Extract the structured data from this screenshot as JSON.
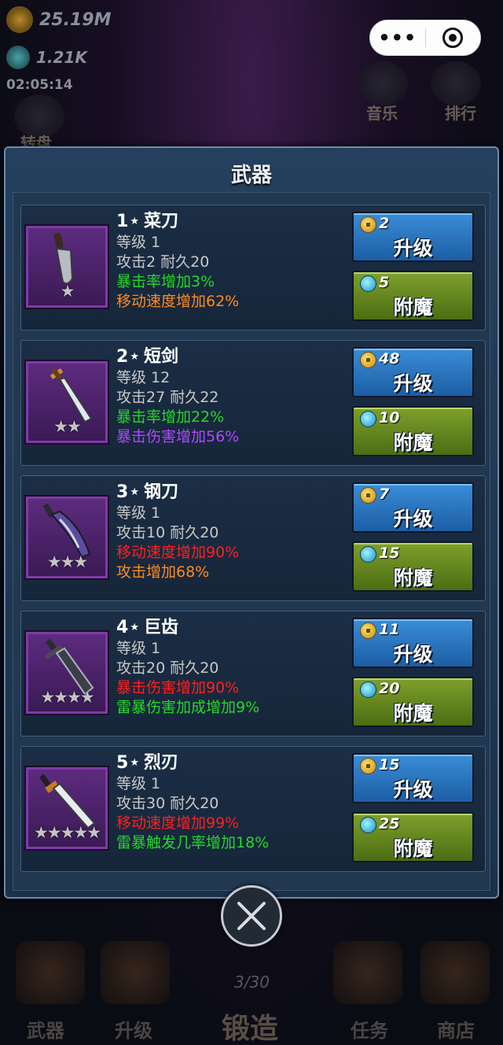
{
  "hud": {
    "gold": "25.19M",
    "gems": "1.21K",
    "timer": "02:05:14"
  },
  "top_menu": {
    "music": "音乐",
    "rank": "排行",
    "partial_left": "转盘"
  },
  "panel": {
    "title": "武器"
  },
  "weapons": [
    {
      "rank": "1",
      "name": "菜刀",
      "level": "等级 1",
      "attack_durability": "攻击2 耐久20",
      "bonus1": "暴击率增加3%",
      "bonus1_color": "#27d72a",
      "bonus2": "移动速度增加62%",
      "bonus2_color": "#ff8a1c",
      "stars": 1,
      "upgrade_cost": "2",
      "upgrade_label": "升级",
      "enchant_cost": "5",
      "enchant_label": "附魔",
      "icon": "kitchen-knife-icon"
    },
    {
      "rank": "2",
      "name": "短剑",
      "level": "等级 12",
      "attack_durability": "攻击27 耐久22",
      "bonus1": "暴击率增加22%",
      "bonus1_color": "#27d72a",
      "bonus2": "暴击伤害增加56%",
      "bonus2_color": "#b048ff",
      "stars": 2,
      "upgrade_cost": "48",
      "upgrade_label": "升级",
      "enchant_cost": "10",
      "enchant_label": "附魔",
      "icon": "short-sword-icon"
    },
    {
      "rank": "3",
      "name": "钢刀",
      "level": "等级 1",
      "attack_durability": "攻击10 耐久20",
      "bonus1": "移动速度增加90%",
      "bonus1_color": "#ff2020",
      "bonus2": "攻击增加68%",
      "bonus2_color": "#ff8a1c",
      "stars": 3,
      "upgrade_cost": "7",
      "upgrade_label": "升级",
      "enchant_cost": "15",
      "enchant_label": "附魔",
      "icon": "steel-blade-icon"
    },
    {
      "rank": "4",
      "name": "巨齿",
      "level": "等级 1",
      "attack_durability": "攻击20 耐久20",
      "bonus1": "暴击伤害增加90%",
      "bonus1_color": "#ff2020",
      "bonus2": "雷暴伤害加成增加9%",
      "bonus2_color": "#27d72a",
      "stars": 4,
      "upgrade_cost": "11",
      "upgrade_label": "升级",
      "enchant_cost": "20",
      "enchant_label": "附魔",
      "icon": "great-sword-icon"
    },
    {
      "rank": "5",
      "name": "烈刃",
      "level": "等级 1",
      "attack_durability": "攻击30 耐久20",
      "bonus1": "移动速度增加99%",
      "bonus1_color": "#ff2020",
      "bonus2": "雷暴触发几率增加18%",
      "bonus2_color": "#27d72a",
      "stars": 5,
      "upgrade_cost": "15",
      "upgrade_label": "升级",
      "enchant_cost": "25",
      "enchant_label": "附魔",
      "icon": "flame-blade-icon"
    }
  ],
  "bottom_nav": {
    "weapons": "武器",
    "upgrade": "升级",
    "forge": "锻造",
    "tasks": "任务",
    "shop": "商店",
    "counter": "3/30"
  }
}
